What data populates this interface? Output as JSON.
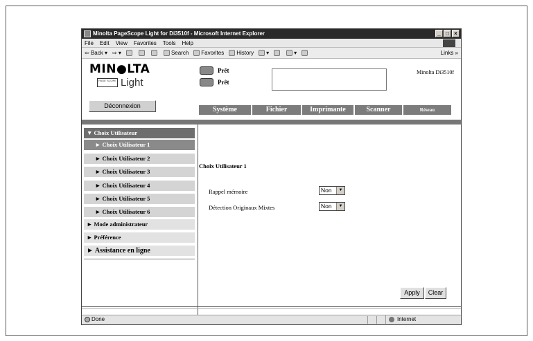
{
  "window": {
    "title": "Minolta PageScope Light for Di3510f - Microsoft Internet Explorer"
  },
  "menu": [
    "File",
    "Edit",
    "View",
    "Favorites",
    "Tools",
    "Help"
  ],
  "toolbar": {
    "back": "Back",
    "search": "Search",
    "favorites": "Favorites",
    "history": "History",
    "links": "Links »"
  },
  "header": {
    "brand": "MIN●LTA",
    "product_small": "PAGE SCOPE",
    "product": "Light",
    "status1": "Prêt",
    "status2": "Prêt",
    "model": "Minolta Di3510f",
    "logout": "Déconnexion"
  },
  "tabs": [
    "Système",
    "Fichier",
    "Imprimante",
    "Scanner",
    "Réseau"
  ],
  "sidebar": {
    "section": "▼ Choix Utilisateur",
    "items": [
      "► Choix Utilisateur   1",
      "► Choix Utilisateur   2",
      "► Choix Utilisateur   3",
      "► Choix Utilisateur   4",
      "► Choix Utilisateur   5",
      "► Choix Utilisateur   6"
    ],
    "admin": "► Mode administrateur",
    "pref": "► Préférence",
    "help": "► Assistance en ligne"
  },
  "main": {
    "title": "Choix Utilisateur   1",
    "rows": [
      {
        "label": "Rappel mémoire",
        "value": "Non"
      },
      {
        "label": "Détection Originaux Mixtes",
        "value": "Non"
      }
    ],
    "apply": "Apply",
    "clear": "Clear"
  },
  "statusbar": {
    "done": "Done",
    "zone": "Internet"
  }
}
